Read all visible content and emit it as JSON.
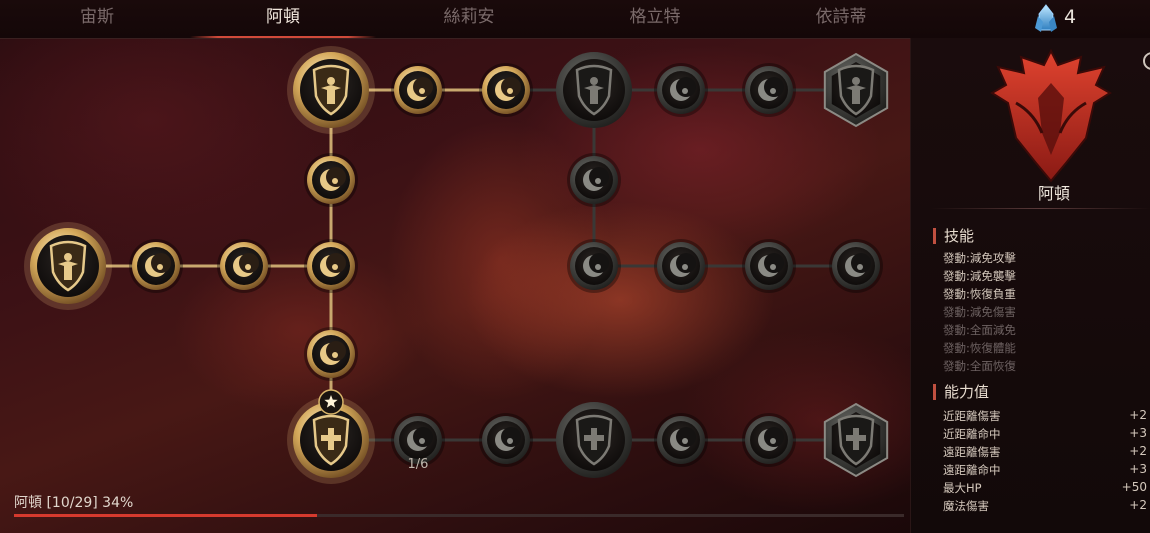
{
  "tabs": [
    "宙斯",
    "阿頓",
    "絲莉安",
    "格立特",
    "依詩蒂"
  ],
  "active_tab": 1,
  "gem": {
    "icon": "crystal-icon",
    "count": "4"
  },
  "tree": {
    "node_counter": "1/6",
    "nodes": [
      {
        "type": "shield",
        "state": "active",
        "icon": "warrior-shield-icon"
      },
      {
        "type": "moon",
        "state": "active",
        "icon": "moon-icon"
      },
      {
        "type": "moon",
        "state": "active",
        "icon": "moon-icon"
      },
      {
        "type": "moon",
        "state": "active",
        "icon": "moon-icon"
      },
      {
        "type": "moon",
        "state": "active",
        "icon": "moon-icon"
      },
      {
        "type": "shield",
        "state": "active",
        "icon": "winged-shield-icon"
      },
      {
        "type": "moon",
        "state": "active",
        "icon": "moon-icon"
      },
      {
        "type": "moon",
        "state": "active",
        "icon": "moon-icon"
      },
      {
        "type": "shield",
        "state": "locked",
        "icon": "crowned-shield-icon"
      },
      {
        "type": "moon",
        "state": "locked",
        "icon": "moon-icon"
      },
      {
        "type": "moon",
        "state": "locked",
        "icon": "moon-icon"
      },
      {
        "type": "hex",
        "state": "locked",
        "icon": "laurel-shield-icon"
      },
      {
        "type": "moon",
        "state": "locked",
        "icon": "moon-icon"
      },
      {
        "type": "moon",
        "state": "locked",
        "icon": "moon-icon"
      },
      {
        "type": "moon",
        "state": "locked",
        "icon": "moon-icon"
      },
      {
        "type": "moon",
        "state": "locked",
        "icon": "moon-icon"
      },
      {
        "type": "moon",
        "state": "locked",
        "icon": "moon-icon"
      },
      {
        "type": "moon",
        "state": "active",
        "icon": "moon-icon"
      },
      {
        "type": "shield",
        "state": "active",
        "icon": "cross-shield-icon",
        "star": true
      },
      {
        "type": "moon",
        "state": "locked",
        "icon": "moon-icon"
      },
      {
        "type": "moon",
        "state": "locked",
        "icon": "moon-icon"
      },
      {
        "type": "shield",
        "state": "locked",
        "icon": "cross-shield-icon"
      },
      {
        "type": "moon",
        "state": "locked",
        "icon": "moon-icon"
      },
      {
        "type": "moon",
        "state": "locked",
        "icon": "moon-icon"
      },
      {
        "type": "hex",
        "state": "locked",
        "icon": "laurel-cross-icon"
      }
    ]
  },
  "bottom": {
    "label": "阿頓 [10/29] 34%",
    "progress": 0.34
  },
  "panel": {
    "class_name": "阿頓",
    "crest_icon": "phoenix-crest-icon",
    "skills_title": "技能",
    "skills": [
      {
        "label": "發動:減免攻擊",
        "enabled": true
      },
      {
        "label": "發動:減免襲擊",
        "enabled": true
      },
      {
        "label": "發動:恢復負重",
        "enabled": true
      },
      {
        "label": "發動:減免傷害",
        "enabled": false
      },
      {
        "label": "發動:全面減免",
        "enabled": false
      },
      {
        "label": "發動:恢復體能",
        "enabled": false
      },
      {
        "label": "發動:全面恢復",
        "enabled": false
      }
    ],
    "stats_title": "能力值",
    "stats": [
      {
        "label": "近距離傷害",
        "value": "+2"
      },
      {
        "label": "近距離命中",
        "value": "+3"
      },
      {
        "label": "遠距離傷害",
        "value": "+2"
      },
      {
        "label": "遠距離命中",
        "value": "+3"
      },
      {
        "label": "最大HP",
        "value": "+50"
      },
      {
        "label": "魔法傷害",
        "value": "+2"
      }
    ]
  },
  "colors": {
    "accent_red": "#d63a2e",
    "gold": "#d9b56a",
    "locked_ring": "#4a4a48"
  }
}
